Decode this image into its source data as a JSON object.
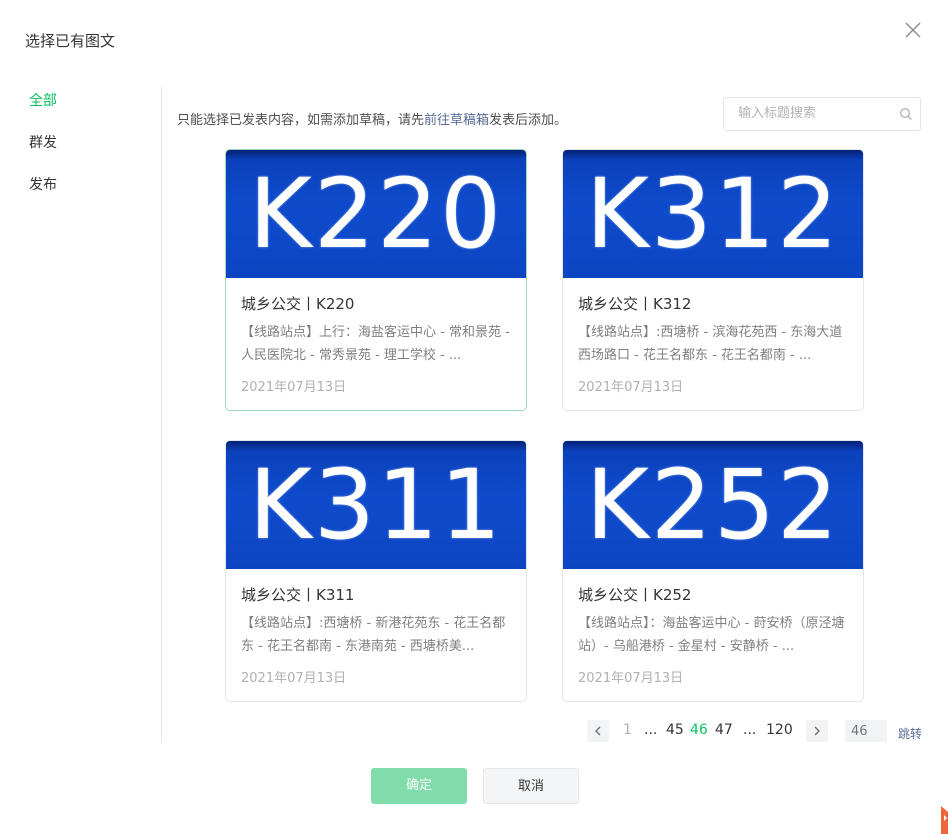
{
  "dialog": {
    "title": "选择已有图文"
  },
  "sidebar": {
    "items": [
      {
        "label": "全部",
        "active": true
      },
      {
        "label": "群发",
        "active": false
      },
      {
        "label": "发布",
        "active": false
      }
    ]
  },
  "notice": {
    "prefix": "只能选择已发表内容，如需添加草稿，请先",
    "link": "前往草稿箱",
    "suffix": "发表后添加。"
  },
  "search": {
    "placeholder": "输入标题搜索",
    "value": ""
  },
  "cards": [
    {
      "cover_text": "K220",
      "title": "城乡公交丨K220",
      "desc": "【线路站点】上行：海盐客运中心 - 常和景苑 - 人民医院北 - 常秀景苑 - 理工学校 - ...",
      "date": "2021年07月13日",
      "selected": true
    },
    {
      "cover_text": "K312",
      "title": "城乡公交丨K312",
      "desc": "【线路站点】:西塘桥 - 滨海花苑西 - 东海大道西场路口 - 花王名都东 - 花王名都南 - ...",
      "date": "2021年07月13日",
      "selected": false
    },
    {
      "cover_text": "K311",
      "title": "城乡公交丨K311",
      "desc": "【线路站点】:西塘桥 - 新港花苑东 - 花王名都东 - 花王名都南 - 东港南苑 - 西塘桥美...",
      "date": "2021年07月13日",
      "selected": false
    },
    {
      "cover_text": "K252",
      "title": "城乡公交丨K252",
      "desc": "【线路站点】：海盐客运中心 - 莳安桥（原泾塘站）- 乌船港桥 - 金星村 - 安静桥 - ...",
      "date": "2021年07月13日",
      "selected": false
    }
  ],
  "pagination": {
    "first": "1",
    "ellipsis": "...",
    "prev_page": "45",
    "current": "46",
    "next_page": "47",
    "last": "120",
    "jump_value": "46",
    "jump_label": "跳转"
  },
  "buttons": {
    "confirm": "确定",
    "cancel": "取消"
  },
  "colors": {
    "accent": "#07c160",
    "link": "#576b95",
    "confirm_disabled": "#80dcaa"
  }
}
